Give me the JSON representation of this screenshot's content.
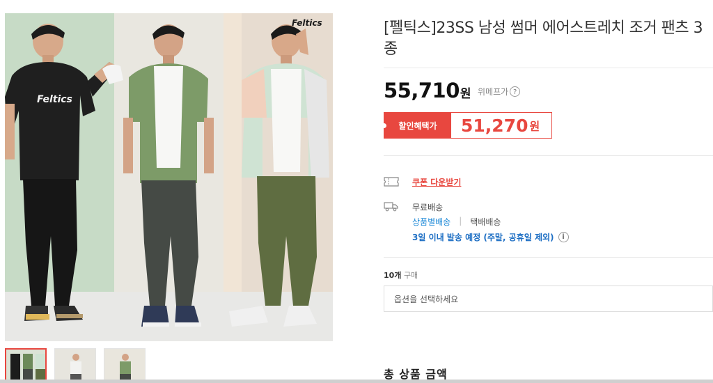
{
  "product": {
    "title": "[펠틱스]23SS 남성 썸머 에어스트레치 조거 팬츠 3종",
    "brand_logo": "Feltics",
    "shirt_logo": "Feltics"
  },
  "pricing": {
    "price": "55,710",
    "price_unit": "원",
    "price_label": "위메프가",
    "discount_label": "할인혜택가",
    "discount_price": "51,270",
    "discount_unit": "원"
  },
  "coupon": {
    "label": "쿠폰 다운받기",
    "icon": "coupon-icon"
  },
  "shipping": {
    "icon": "truck-icon",
    "fee": "무료배송",
    "type": "상품별배송",
    "separator": "|",
    "kind": "택배배송",
    "eta": "3일 이내 발송 예정 (주말, 공휴일 제외)"
  },
  "purchase": {
    "count": "10개",
    "count_suffix": "구매",
    "option_placeholder": "옵션을 선택하세요",
    "total_label": "총 상품 금액"
  },
  "colors": {
    "accent_red": "#e8473f",
    "link_blue": "#1e8ad8",
    "eta_blue": "#1e6fc4"
  }
}
